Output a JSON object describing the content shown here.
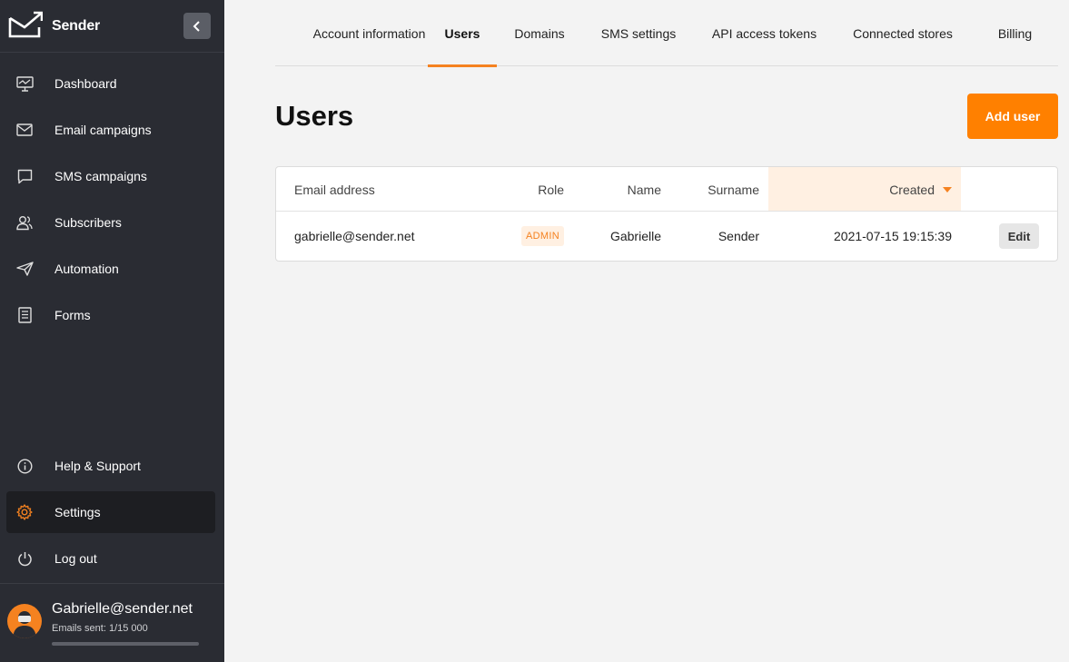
{
  "brand": {
    "name": "Sender"
  },
  "sidebar": {
    "items": [
      {
        "label": "Dashboard",
        "icon": "dashboard-icon"
      },
      {
        "label": "Email campaigns",
        "icon": "envelope-icon"
      },
      {
        "label": "SMS campaigns",
        "icon": "chat-bubble-icon"
      },
      {
        "label": "Subscribers",
        "icon": "users-icon"
      },
      {
        "label": "Automation",
        "icon": "paper-plane-icon"
      },
      {
        "label": "Forms",
        "icon": "form-icon"
      }
    ],
    "bottom_items": [
      {
        "label": "Help & Support",
        "icon": "info-icon"
      },
      {
        "label": "Settings",
        "icon": "gear-icon",
        "active": true
      },
      {
        "label": "Log out",
        "icon": "power-icon"
      }
    ]
  },
  "user": {
    "email": "Gabrielle@sender.net",
    "emails_sent": "Emails sent: 1/15 000",
    "usage_fraction": 0.0001
  },
  "tabs": [
    {
      "label": "Account information"
    },
    {
      "label": "Users",
      "active": true
    },
    {
      "label": "Domains"
    },
    {
      "label": "SMS settings"
    },
    {
      "label": "API access tokens"
    },
    {
      "label": "Connected stores"
    },
    {
      "label": "Billing"
    }
  ],
  "page": {
    "title": "Users",
    "add_user_label": "Add user"
  },
  "table": {
    "columns": [
      "Email address",
      "Role",
      "Name",
      "Surname",
      "Created"
    ],
    "sort_column": "Created",
    "sort_direction": "desc",
    "rows": [
      {
        "email": "gabrielle@sender.net",
        "role": "ADMIN",
        "name": "Gabrielle",
        "surname": "Sender",
        "created": "2021-07-15 19:15:39",
        "action": "Edit"
      }
    ]
  },
  "colors": {
    "accent": "#ff8000",
    "sidebar_bg": "#2a2c33",
    "active_bg": "#1d1e22",
    "page_bg": "#f3f3f3"
  }
}
